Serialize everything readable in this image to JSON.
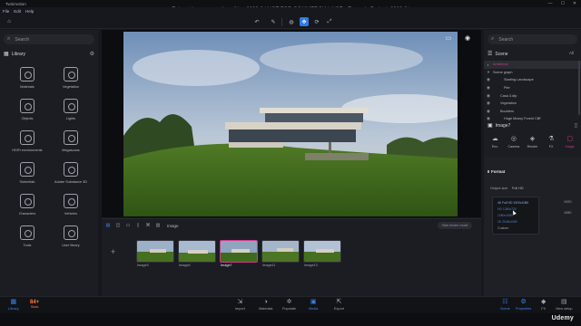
{
  "window": {
    "app_name": "Twinmotion",
    "title": "Twinmotion community edition 2023.2 | NOT FOR COMMERCIAL USE - Example Project_2023.2*",
    "minimize": "—",
    "maximize": "☐",
    "close": "✕"
  },
  "menu": [
    "File",
    "Edit",
    "Help"
  ],
  "library": {
    "search_placeholder": "Search",
    "title": "Library",
    "items": [
      {
        "label": "Materials"
      },
      {
        "label": "Vegetation"
      },
      {
        "label": "Objects"
      },
      {
        "label": "Lights"
      },
      {
        "label": "HDRI environments"
      },
      {
        "label": "Megascans"
      },
      {
        "label": "Sketchfab"
      },
      {
        "label": "Adobe Substance 3D"
      },
      {
        "label": "Characters"
      },
      {
        "label": "Vehicles"
      },
      {
        "label": "Tools"
      },
      {
        "label": "User library"
      }
    ]
  },
  "timeline": {
    "label": "Image",
    "render_button": "Start render mode",
    "thumbnails": [
      {
        "name": "Image3"
      },
      {
        "name": "Image4"
      },
      {
        "name": "Image7"
      },
      {
        "name": "Image11"
      },
      {
        "name": "Image13"
      }
    ],
    "active_index": 2
  },
  "bottom_bar": {
    "left": [
      {
        "label": "Library",
        "icon": "library-icon"
      }
    ],
    "stats_number": "84+",
    "stats_label": "Stats",
    "center": [
      {
        "label": "Import",
        "icon": "import-icon"
      },
      {
        "label": "Materials",
        "icon": "materials-icon"
      },
      {
        "label": "Populate",
        "icon": "populate-icon"
      },
      {
        "label": "Media",
        "icon": "media-icon"
      },
      {
        "label": "Export",
        "icon": "export-icon"
      }
    ],
    "right": [
      {
        "label": "Scene",
        "icon": "scene-icon"
      },
      {
        "label": "Properties",
        "icon": "properties-icon"
      },
      {
        "label": "FX",
        "icon": "fx-icon"
      },
      {
        "label": "View setup",
        "icon": "view-setup-icon"
      }
    ],
    "active_center": "Media",
    "active_right": [
      "Scene",
      "Properties"
    ]
  },
  "scene_panel": {
    "search_placeholder": "Search",
    "title": "Scene",
    "filter": "All",
    "tree": [
      {
        "label": "Ambience",
        "highlight": true
      },
      {
        "label": "Scene graph"
      },
      {
        "label": "Starting Landscape"
      },
      {
        "label": "Pier"
      },
      {
        "label": "Casa 3.dtp"
      },
      {
        "label": "Vegetation"
      },
      {
        "label": "Boulders"
      },
      {
        "label": "Huge Mossy Forest Cliff"
      }
    ]
  },
  "properties": {
    "title": "Image7",
    "tabs": [
      {
        "label": "Env."
      },
      {
        "label": "Camera"
      },
      {
        "label": "Render"
      },
      {
        "label": "FX"
      },
      {
        "label": "Image"
      }
    ],
    "active_tab": "Image",
    "format_title": "Format",
    "output_label": "Output size",
    "output_value": "Full HD",
    "dropdown_options": [
      "4K Full HD 1920x1080",
      "HD 1280x720",
      "1080x1080",
      "2K 2048x1080"
    ],
    "selected_option": "4K Full HD 1920x1080",
    "custom_label": "Custom",
    "value_a": "1920",
    "value_b": "1080"
  },
  "watermark": "Udemy",
  "colors": {
    "accent_blue": "#2e7be6",
    "accent_pink": "#d23a8a",
    "stats_orange": "#ff7a3d"
  }
}
